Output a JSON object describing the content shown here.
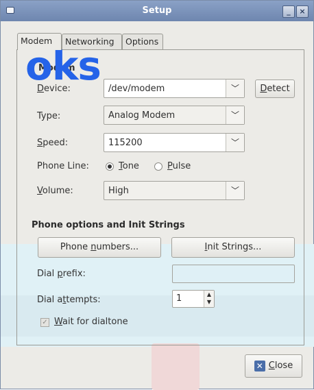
{
  "window": {
    "title": "Setup"
  },
  "watermark": {
    "text": "oks"
  },
  "tabs": [
    {
      "label": "Modem",
      "active": true
    },
    {
      "label": "Networking",
      "active": false
    },
    {
      "label": "Options",
      "active": false
    }
  ],
  "modem": {
    "group_title": "Modem",
    "device": {
      "label_first": "D",
      "label_rest": "evice:",
      "value": "/dev/modem",
      "detect_first": "D",
      "detect_rest": "etect"
    },
    "type": {
      "label": "Type:",
      "value": "Analog Modem"
    },
    "speed": {
      "label_first": "S",
      "label_rest": "peed:",
      "value": "115200"
    },
    "phone_line": {
      "label": "Phone Line:",
      "options": [
        {
          "first": "T",
          "rest": "one",
          "checked": true
        },
        {
          "first": "P",
          "rest": "ulse",
          "checked": false
        }
      ]
    },
    "volume": {
      "label_first": "V",
      "label_rest": "olume:",
      "value": "High"
    }
  },
  "phone_options": {
    "section_title": "Phone options and Init Strings",
    "phone_numbers_btn": {
      "pre": "Phone ",
      "u": "n",
      "post": "umbers..."
    },
    "init_strings_btn": {
      "u": "I",
      "post": "nit Strings..."
    },
    "dial_prefix": {
      "pre": "Dial ",
      "u": "p",
      "post": "refix:",
      "value": ""
    },
    "dial_attempts": {
      "pre": "Dial a",
      "u": "t",
      "post": "tempts:",
      "value": "1"
    },
    "wait_dialtone": {
      "u": "W",
      "post": "ait for dialtone",
      "checked": true
    }
  },
  "footer": {
    "close_u": "C",
    "close_rest": "lose"
  }
}
